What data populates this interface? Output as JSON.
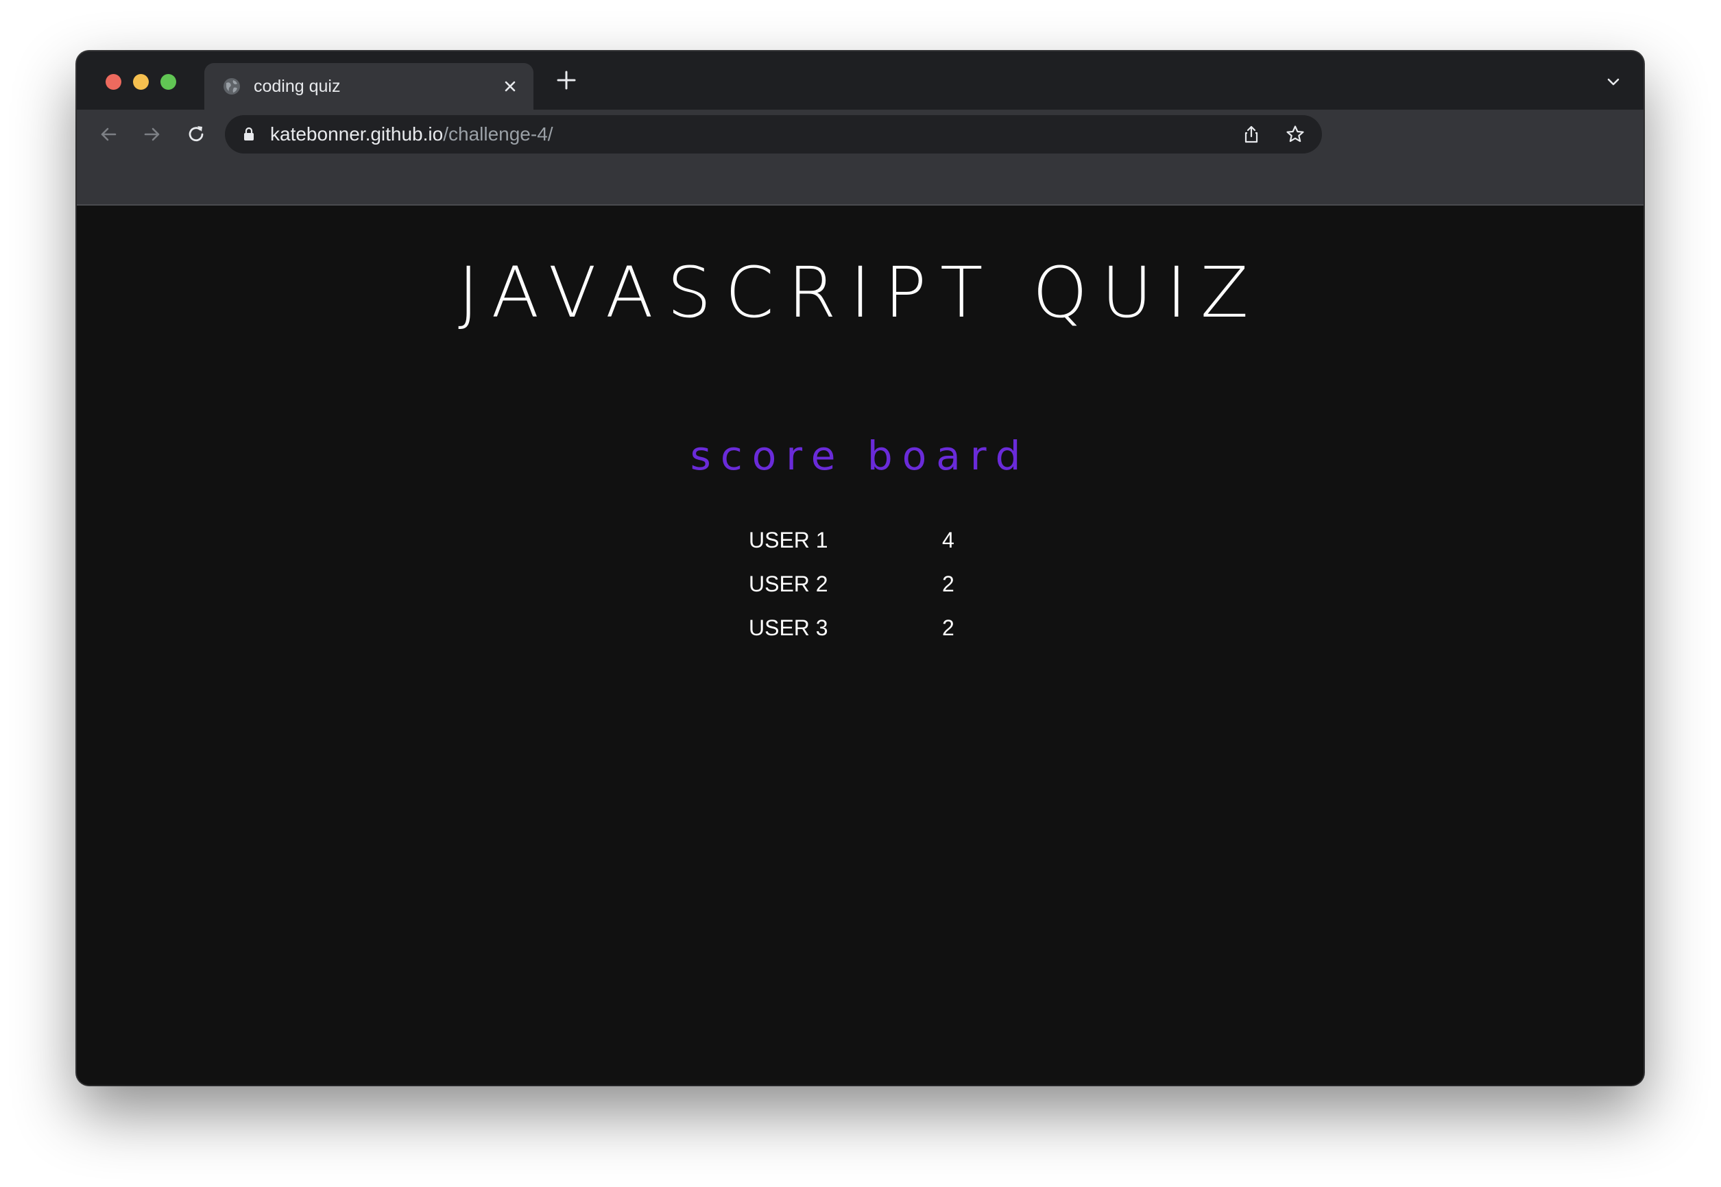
{
  "browser": {
    "tab": {
      "title": "coding quiz"
    },
    "omnibox": {
      "host": "katebonner.github.io",
      "path": "/challenge-4/"
    }
  },
  "page": {
    "title": "JAVASCRIPT QUIZ",
    "board_title": "score board",
    "board_title_color": "#6a2bd9",
    "scores": [
      {
        "name": "USER 1",
        "score": "4"
      },
      {
        "name": "USER 2",
        "score": "2"
      },
      {
        "name": "USER 3",
        "score": "2"
      }
    ]
  }
}
